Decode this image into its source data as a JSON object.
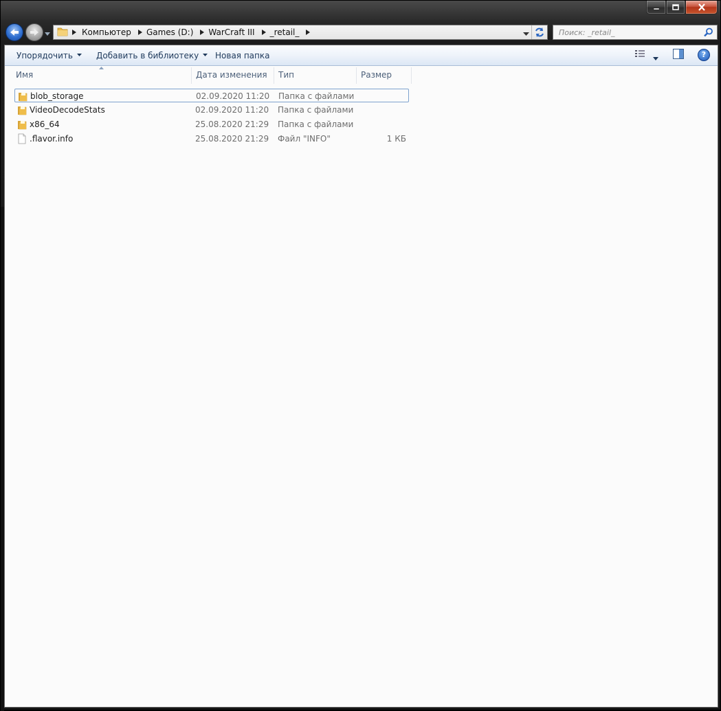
{
  "window": {
    "caption_buttons": {
      "minimize": "minimize-icon",
      "maximize": "maximize-icon",
      "close": "close-icon"
    }
  },
  "nav": {
    "breadcrumb": [
      {
        "label": "Компьютер"
      },
      {
        "label": "Games (D:)"
      },
      {
        "label": "WarCraft III"
      },
      {
        "label": "_retail_"
      }
    ],
    "search_placeholder": "Поиск: _retail_"
  },
  "toolbar": {
    "organize": "Упорядочить",
    "add_to_library": "Добавить в библиотеку",
    "new_folder": "Новая папка"
  },
  "columns": {
    "name": "Имя",
    "date": "Дата изменения",
    "type": "Тип",
    "size": "Размер"
  },
  "files": [
    {
      "name": "blob_storage",
      "date": "02.09.2020 11:20",
      "type": "Папка с файлами",
      "size": "",
      "icon": "folder-icon"
    },
    {
      "name": "VideoDecodeStats",
      "date": "02.09.2020 11:20",
      "type": "Папка с файлами",
      "size": "",
      "icon": "folder-icon"
    },
    {
      "name": "x86_64",
      "date": "25.08.2020 21:29",
      "type": "Папка с файлами",
      "size": "",
      "icon": "folder-icon"
    },
    {
      "name": ".flavor.info",
      "date": "25.08.2020 21:29",
      "type": "Файл \"INFO\"",
      "size": "1 КБ",
      "icon": "file-icon"
    }
  ],
  "colors": {
    "accent": "#1e395b",
    "selection_border": "#7da2ce",
    "header_text": "#4c607a"
  }
}
